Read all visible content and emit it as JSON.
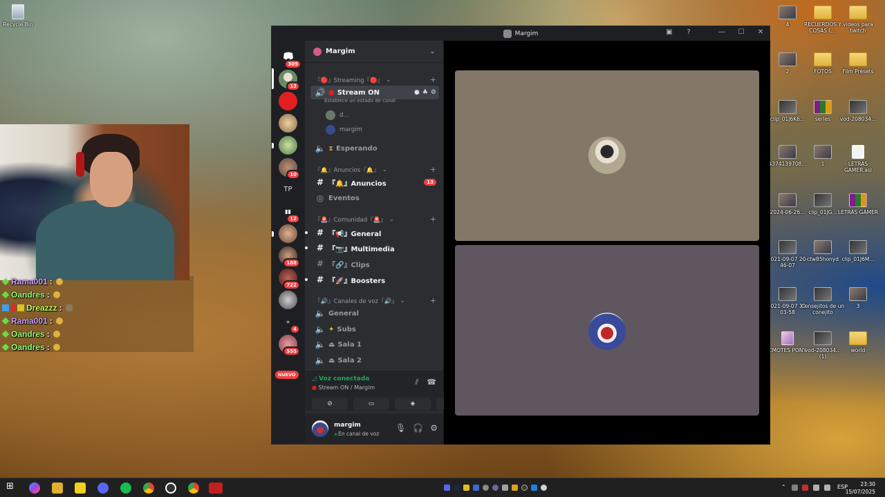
{
  "desktop": {
    "left_icons": [
      {
        "label": "Recycle Bin",
        "icon": "recycle-bin-icon"
      }
    ],
    "right_icons": [
      {
        "label": "4",
        "icon": "photo-thumb"
      },
      {
        "label": "RECUERDOS Y COSAS L...",
        "icon": "folder-icon"
      },
      {
        "label": "videos para twitch",
        "icon": "folder-icon"
      },
      {
        "label": "2",
        "icon": "photo-thumb"
      },
      {
        "label": "FOTOS",
        "icon": "folder-icon"
      },
      {
        "label": "Film Presets",
        "icon": "folder-icon"
      },
      {
        "label": "clip_01J6K6...",
        "icon": "video-thumb"
      },
      {
        "label": "series",
        "icon": "rar-icon"
      },
      {
        "label": "vod-208034...",
        "icon": "video-thumb"
      },
      {
        "label": "4374139708...",
        "icon": "photo-thumb"
      },
      {
        "label": "1",
        "icon": "photo-thumb"
      },
      {
        "label": "LETRAS GAMER.asl",
        "icon": "document-icon"
      },
      {
        "label": "2024-06-26...",
        "icon": "photo-thumb"
      },
      {
        "label": "clip_01JG...",
        "icon": "video-thumb"
      },
      {
        "label": "LETRAS GAMER",
        "icon": "rar-icon"
      },
      {
        "label": "2021-09-07 20-46-07",
        "icon": "video-thumb"
      },
      {
        "label": "ctw85honyd",
        "icon": "photo-thumb"
      },
      {
        "label": "clip_01J6M...",
        "icon": "video-thumb"
      },
      {
        "label": "2021-09-07 19-03-58",
        "icon": "video-thumb"
      },
      {
        "label": "Consejitos de un conejito",
        "icon": "video-thumb"
      },
      {
        "label": "3",
        "icon": "photo-thumb"
      },
      {
        "label": "EMOTES PONY",
        "icon": "pony-icon"
      },
      {
        "label": "vod-208034... (1)",
        "icon": "video-thumb"
      },
      {
        "label": "world",
        "icon": "folder-icon"
      }
    ]
  },
  "chat": {
    "lines": [
      {
        "user": "Rama001",
        "sep": " :",
        "color": "purple"
      },
      {
        "user": "Oandres",
        "sep": " :",
        "color": "green"
      },
      {
        "user": "Dreazzz",
        "sep": " :",
        "color": "yellow"
      },
      {
        "user": "Rama001",
        "sep": " :",
        "color": "purple"
      },
      {
        "user": "Oandres",
        "sep": " :",
        "color": "green"
      },
      {
        "user": "Oandres",
        "sep": " :",
        "color": "green"
      }
    ]
  },
  "discord": {
    "window_title": "Margim",
    "server_badges": [
      "309",
      "13",
      "10",
      "12",
      "188",
      "722",
      "4",
      "555"
    ],
    "server_initials": "TP",
    "new_label": "NUEVO",
    "server_name": "Margim",
    "categories": {
      "streaming": "『🔴』Streaming『🔴』",
      "anuncios": "『🔔』Anuncios『🔔』",
      "comunidad": "『🚨』Comunidad『🚨』",
      "voz": "『🔊』Canales de voz『🔊』"
    },
    "channels": {
      "stream_on": "Stream ON",
      "stream_on_status": "Establece un estado de canal",
      "vc_user_1": "d...",
      "vc_user_2": "margim",
      "esperando": "Esperando",
      "anuncios": "『🔔』Anuncios",
      "anuncios_badge": "13",
      "eventos": "Eventos",
      "general": "『📢』General",
      "multimedia": "『📷』Multimedia",
      "clips": "『🔗』Clips",
      "boosters": "『🚀』Boosters",
      "voz_general": "General",
      "subs": "Subs",
      "sala1": "Sala 1",
      "sala2": "Sala 2"
    },
    "voice_panel": {
      "status": "Voz conectada",
      "channel": "Stream ON / Margim"
    },
    "user": {
      "name": "margim",
      "status": "En canal de voz"
    }
  },
  "taskbar": {
    "lang": "ESP",
    "time": "23:30",
    "date": "15/07/2025"
  }
}
